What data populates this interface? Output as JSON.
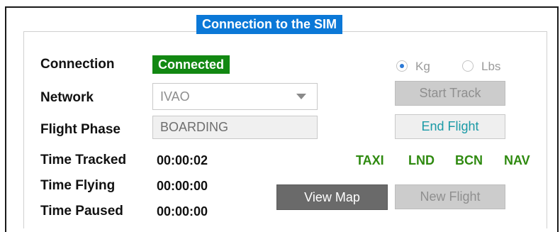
{
  "panel": {
    "title": "Connection to the SIM"
  },
  "labels": {
    "connection": "Connection",
    "network": "Network",
    "flight_phase": "Flight Phase",
    "time_tracked": "Time Tracked",
    "time_flying": "Time Flying",
    "time_paused": "Time Paused"
  },
  "status": {
    "connection": "Connected",
    "connection_color": "#128812"
  },
  "network": {
    "selected": "IVAO"
  },
  "flight_phase": {
    "value": "BOARDING"
  },
  "timers": {
    "tracked": "00:00:02",
    "flying": "00:00:00",
    "paused": "00:00:00"
  },
  "units": {
    "kg_label": "Kg",
    "lbs_label": "Lbs",
    "selected": "Kg"
  },
  "buttons": {
    "start_track": "Start Track",
    "end_flight": "End Flight",
    "view_map": "View Map",
    "new_flight": "New Flight"
  },
  "indicators": [
    {
      "label": "TAXI",
      "color": "#2f8a10"
    },
    {
      "label": "LND",
      "color": "#2f8a10"
    },
    {
      "label": "BCN",
      "color": "#2f8a10"
    },
    {
      "label": "NAV",
      "color": "#2f8a10"
    }
  ],
  "colors": {
    "title_bg": "#0b78d7",
    "accent_text": "#1a9aa6"
  }
}
